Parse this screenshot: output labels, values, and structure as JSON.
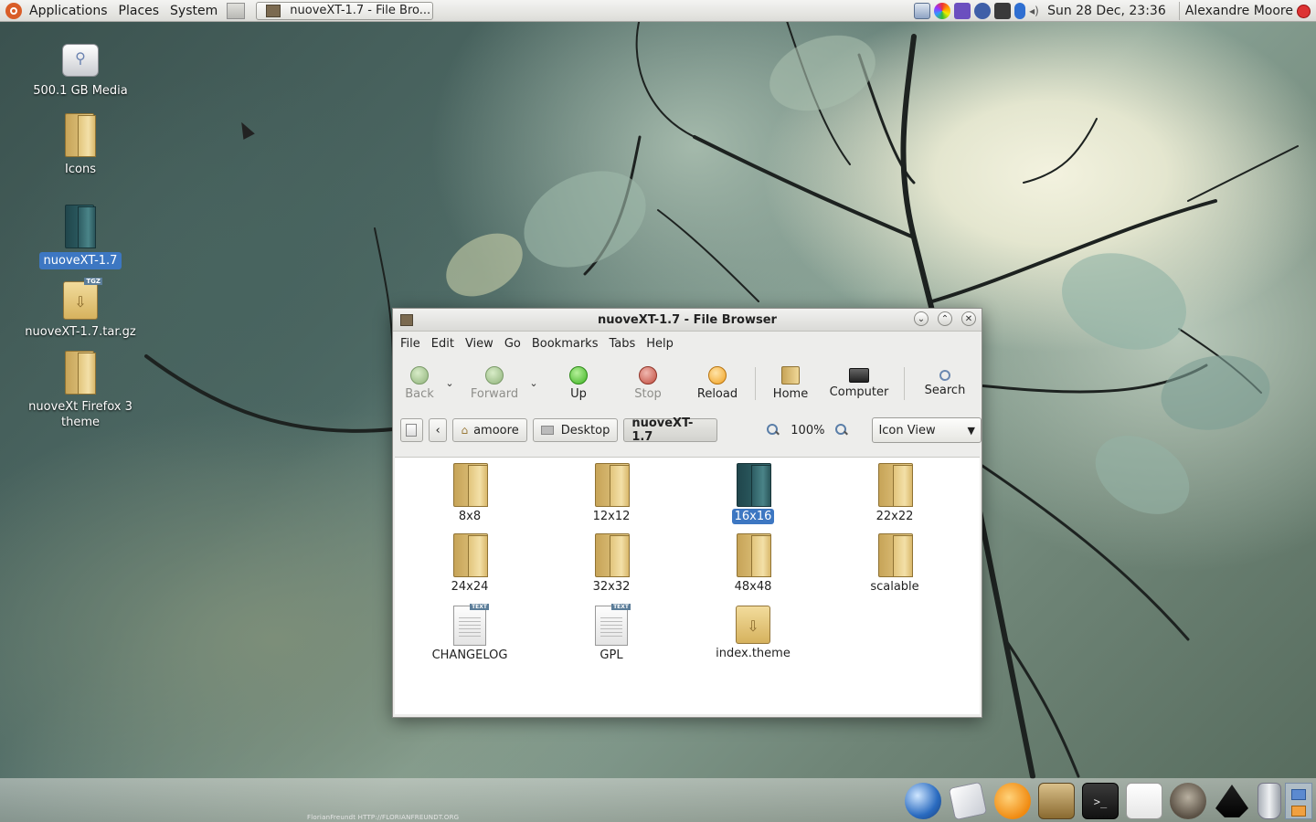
{
  "top_panel": {
    "menus": [
      "Applications",
      "Places",
      "System"
    ],
    "task_button_label": "nuoveXT-1.7 - File Bro...",
    "clock": "Sun 28 Dec, 23:36",
    "user": "Alexandre Moore"
  },
  "desktop": {
    "icons": [
      {
        "label": "500.1 GB Media",
        "kind": "drive-icon"
      },
      {
        "label": "Icons",
        "kind": "folder-icon"
      },
      {
        "label": "nuoveXT-1.7",
        "kind": "folder-icon",
        "selected": true
      },
      {
        "label": "nuoveXT-1.7.tar.gz",
        "kind": "archive-icon"
      },
      {
        "label": "nuoveXt Firefox 3 theme",
        "kind": "folder-icon"
      }
    ]
  },
  "window": {
    "title": "nuoveXT-1.7 - File Browser",
    "menubar": [
      "File",
      "Edit",
      "View",
      "Go",
      "Bookmarks",
      "Tabs",
      "Help"
    ],
    "toolbar": {
      "back": "Back",
      "forward": "Forward",
      "up": "Up",
      "stop": "Stop",
      "reload": "Reload",
      "home": "Home",
      "computer": "Computer",
      "search": "Search"
    },
    "location": {
      "crumbs": [
        "amoore",
        "Desktop",
        "nuoveXT-1.7"
      ],
      "zoom": "100%",
      "view_mode": "Icon View"
    },
    "items": [
      {
        "label": "8x8",
        "type": "folder"
      },
      {
        "label": "12x12",
        "type": "folder"
      },
      {
        "label": "16x16",
        "type": "folder",
        "selected": true
      },
      {
        "label": "22x22",
        "type": "folder"
      },
      {
        "label": "24x24",
        "type": "folder"
      },
      {
        "label": "32x32",
        "type": "folder"
      },
      {
        "label": "48x48",
        "type": "folder"
      },
      {
        "label": "scalable",
        "type": "folder"
      },
      {
        "label": "CHANGELOG",
        "type": "text"
      },
      {
        "label": "GPL",
        "type": "text"
      },
      {
        "label": "index.theme",
        "type": "package"
      }
    ]
  },
  "wallpaper_credit": "FlorianFreundt     HTTP://FLORIANFREUNDT.ORG",
  "colors": {
    "selection": "#3d77c2",
    "panel": "#e6e6e2"
  }
}
